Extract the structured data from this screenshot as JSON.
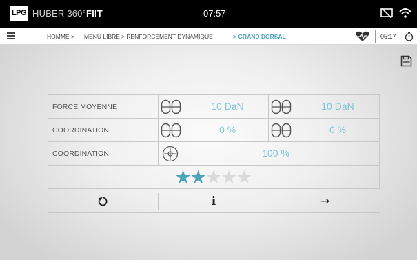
{
  "status_bar": {
    "logo": "LPG",
    "brand_light": "HUBER 360°",
    "brand_bold": "FIIT",
    "time": "07:57",
    "icons": [
      "screen-off-icon",
      "wifi-icon"
    ]
  },
  "breadcrumb": {
    "items": [
      "HOMME >",
      "MENU LIBRE",
      "> RENFORCEMENT DYNAMIQUE",
      "> GRAND DORSAL"
    ],
    "session_time": "05:17",
    "icons": [
      "menu-icon",
      "heart-icon",
      "timer-icon"
    ]
  },
  "toolbar": {
    "save_icon": "save-icon"
  },
  "results": {
    "rows": [
      {
        "label": "FORCE MOYENNE",
        "left_value": "10 DaN",
        "right_value": "10 DaN",
        "icon": "double-pad-icon"
      },
      {
        "label": "COORDINATION",
        "left_value": "0 %",
        "right_value": "0 %",
        "icon": "double-pad-icon"
      },
      {
        "label": "COORDINATION",
        "value": "100 %",
        "icon": "target-icon"
      }
    ],
    "rating": {
      "stars_filled": 2,
      "stars_total": 5
    },
    "colors": {
      "value": "#7ec6d6",
      "star_filled": "#4aa3b8",
      "star_empty": "#d9d9d9"
    }
  },
  "actions": {
    "restart_icon": "restart-icon",
    "info_label": "i",
    "next_label": "→"
  }
}
